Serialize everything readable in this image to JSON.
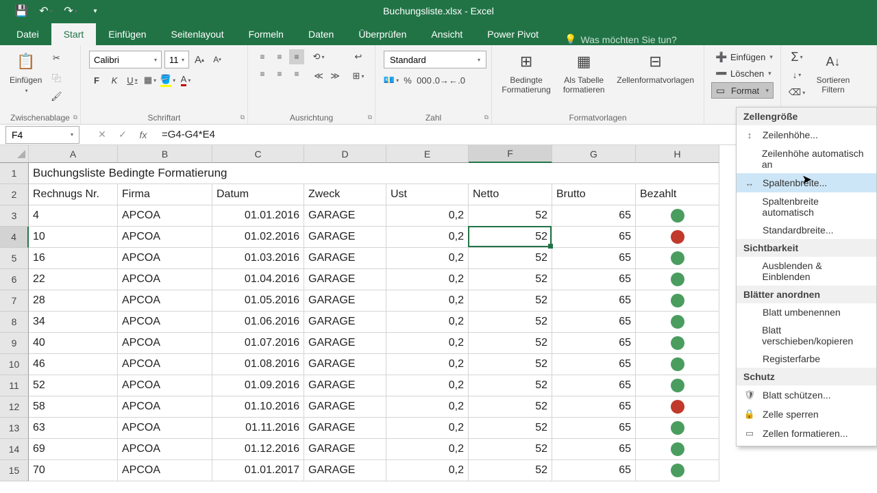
{
  "app": {
    "title": "Buchungsliste.xlsx - Excel"
  },
  "tabs": {
    "datei": "Datei",
    "start": "Start",
    "einfuegen": "Einfügen",
    "seitenlayout": "Seitenlayout",
    "formeln": "Formeln",
    "daten": "Daten",
    "ueberpruefen": "Überprüfen",
    "ansicht": "Ansicht",
    "powerpivot": "Power Pivot",
    "tellme": "Was möchten Sie tun?"
  },
  "ribbon": {
    "clipboard": {
      "label": "Zwischenablage",
      "paste": "Einfügen"
    },
    "font": {
      "label": "Schriftart",
      "name": "Calibri",
      "size": "11"
    },
    "alignment": {
      "label": "Ausrichtung"
    },
    "number": {
      "label": "Zahl",
      "format": "Standard",
      "percent": "%",
      "thousands": "000"
    },
    "styles": {
      "label": "Formatvorlagen",
      "condfmt": "Bedingte Formatierung",
      "astable": "Als Tabelle formatieren",
      "cellstyles": "Zellenformatvorlagen"
    },
    "cells": {
      "insert": "Einfügen",
      "delete": "Löschen",
      "format": "Format"
    },
    "editing": {
      "sort": "Sortieren Filtern"
    }
  },
  "formulabar": {
    "namebox": "F4",
    "formula": "=G4-G4*E4"
  },
  "columns": [
    {
      "letter": "A",
      "width": 130
    },
    {
      "letter": "B",
      "width": 138
    },
    {
      "letter": "C",
      "width": 134
    },
    {
      "letter": "D",
      "width": 120
    },
    {
      "letter": "E",
      "width": 120
    },
    {
      "letter": "F",
      "width": 122
    },
    {
      "letter": "G",
      "width": 122
    },
    {
      "letter": "H",
      "width": 122
    }
  ],
  "selectedCol": "F",
  "selectedRow": 4,
  "headers": {
    "a": "Rechnugs Nr.",
    "b": "Firma",
    "c": "Datum",
    "d": "Zweck",
    "e": "Ust",
    "f": "Netto",
    "g": "Brutto",
    "h": "Bezahlt"
  },
  "title_cell": "Buchungsliste Bedingte Formatierung",
  "rows": [
    {
      "n": 1
    },
    {
      "n": 2
    },
    {
      "n": 3,
      "a": "4",
      "b": "APCOA",
      "c": "01.01.2016",
      "d": "GARAGE",
      "e": "0,2",
      "f": "52",
      "g": "65",
      "h": "green"
    },
    {
      "n": 4,
      "a": "10",
      "b": "APCOA",
      "c": "01.02.2016",
      "d": "GARAGE",
      "e": "0,2",
      "f": "52",
      "g": "65",
      "h": "red"
    },
    {
      "n": 5,
      "a": "16",
      "b": "APCOA",
      "c": "01.03.2016",
      "d": "GARAGE",
      "e": "0,2",
      "f": "52",
      "g": "65",
      "h": "green"
    },
    {
      "n": 6,
      "a": "22",
      "b": "APCOA",
      "c": "01.04.2016",
      "d": "GARAGE",
      "e": "0,2",
      "f": "52",
      "g": "65",
      "h": "green"
    },
    {
      "n": 7,
      "a": "28",
      "b": "APCOA",
      "c": "01.05.2016",
      "d": "GARAGE",
      "e": "0,2",
      "f": "52",
      "g": "65",
      "h": "green"
    },
    {
      "n": 8,
      "a": "34",
      "b": "APCOA",
      "c": "01.06.2016",
      "d": "GARAGE",
      "e": "0,2",
      "f": "52",
      "g": "65",
      "h": "green"
    },
    {
      "n": 9,
      "a": "40",
      "b": "APCOA",
      "c": "01.07.2016",
      "d": "GARAGE",
      "e": "0,2",
      "f": "52",
      "g": "65",
      "h": "green"
    },
    {
      "n": 10,
      "a": "46",
      "b": "APCOA",
      "c": "01.08.2016",
      "d": "GARAGE",
      "e": "0,2",
      "f": "52",
      "g": "65",
      "h": "green"
    },
    {
      "n": 11,
      "a": "52",
      "b": "APCOA",
      "c": "01.09.2016",
      "d": "GARAGE",
      "e": "0,2",
      "f": "52",
      "g": "65",
      "h": "green"
    },
    {
      "n": 12,
      "a": "58",
      "b": "APCOA",
      "c": "01.10.2016",
      "d": "GARAGE",
      "e": "0,2",
      "f": "52",
      "g": "65",
      "h": "red"
    },
    {
      "n": 13,
      "a": "63",
      "b": "APCOA",
      "c": "01.11.2016",
      "d": "GARAGE",
      "e": "0,2",
      "f": "52",
      "g": "65",
      "h": "green"
    },
    {
      "n": 14,
      "a": "69",
      "b": "APCOA",
      "c": "01.12.2016",
      "d": "GARAGE",
      "e": "0,2",
      "f": "52",
      "g": "65",
      "h": "green"
    },
    {
      "n": 15,
      "a": "70",
      "b": "APCOA",
      "c": "01.01.2017",
      "d": "GARAGE",
      "e": "0,2",
      "f": "52",
      "g": "65",
      "h": "green"
    }
  ],
  "ctx": {
    "s1": "Zellengröße",
    "rowheight": "Zeilenhöhe...",
    "rowauto": "Zeilenhöhe automatisch an",
    "colwidth": "Spaltenbreite...",
    "colauto": "Spaltenbreite automatisch",
    "stdwidth": "Standardbreite...",
    "s2": "Sichtbarkeit",
    "hideshow": "Ausblenden & Einblenden",
    "s3": "Blätter anordnen",
    "rename": "Blatt umbenennen",
    "move": "Blatt verschieben/kopieren",
    "tabcolor": "Registerfarbe",
    "s4": "Schutz",
    "protect": "Blatt schützen...",
    "lock": "Zelle sperren",
    "fmtcells": "Zellen formatieren..."
  }
}
